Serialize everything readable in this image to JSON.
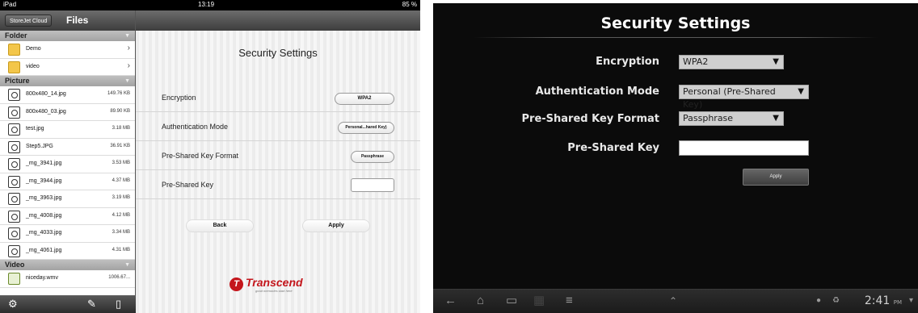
{
  "ipad": {
    "status": {
      "carrier": "iPad",
      "time": "13:19",
      "battery": "85 %"
    },
    "sidebar": {
      "storejet_label": "StoreJet Cloud",
      "title": "Files",
      "sections": {
        "folder": "Folder",
        "picture": "Picture",
        "video": "Video"
      },
      "folders": [
        {
          "name": "Demo"
        },
        {
          "name": "video"
        }
      ],
      "pictures": [
        {
          "name": "800x480_14.jpg",
          "size": "149.76 KB"
        },
        {
          "name": "800x480_03.jpg",
          "size": "89.90 KB"
        },
        {
          "name": "test.jpg",
          "size": "3.18 MB"
        },
        {
          "name": "Step5.JPG",
          "size": "36.91 KB"
        },
        {
          "name": "_mg_3941.jpg",
          "size": "3.53 MB"
        },
        {
          "name": "_mg_3944.jpg",
          "size": "4.37 MB"
        },
        {
          "name": "_mg_3963.jpg",
          "size": "3.19 MB"
        },
        {
          "name": "_mg_4008.jpg",
          "size": "4.12 MB"
        },
        {
          "name": "_mg_4033.jpg",
          "size": "3.34 MB"
        },
        {
          "name": "_mg_4061.jpg",
          "size": "4.31 MB"
        }
      ],
      "videos": [
        {
          "name": "niceday.wmv",
          "size": "1006.67..."
        }
      ],
      "toolbar_icons": [
        "gear-icon",
        "edit-icon",
        "device-icon"
      ]
    },
    "settings": {
      "title": "Security Settings",
      "encryption_label": "Encryption",
      "encryption_value": "WPA2",
      "auth_label": "Authentication Mode",
      "auth_value": "Personal...hared Key)",
      "psk_format_label": "Pre-Shared Key Format",
      "psk_format_value": "Passphrase",
      "psk_label": "Pre-Shared Key",
      "psk_value": "",
      "back_label": "Back",
      "apply_label": "Apply"
    },
    "logo": {
      "brand": "Transcend",
      "tagline": "good memories start here"
    }
  },
  "android": {
    "title": "Security Settings",
    "encryption_label": "Encryption",
    "encryption_value": "WPA2",
    "auth_label": "Authentication Mode",
    "auth_value": "Personal (Pre-Shared Key)",
    "psk_format_label": "Pre-Shared Key Format",
    "psk_format_value": "Passphrase",
    "psk_label": "Pre-Shared Key",
    "psk_value": "",
    "apply_label": "Apply",
    "clock": "2:41",
    "ampm": "PM"
  }
}
